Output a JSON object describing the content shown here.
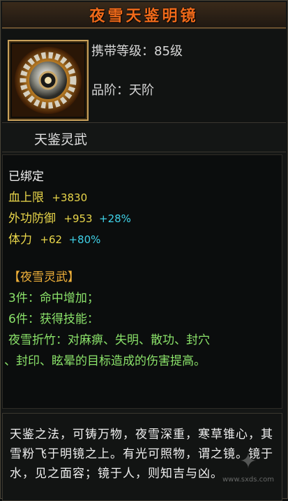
{
  "title": "夜雪天鉴明镜",
  "info": {
    "level_label": "携带等级：85级",
    "grade_label": "品阶：天阶"
  },
  "subtitle": "天鉴灵武",
  "stats": {
    "bound": "已绑定",
    "hp": {
      "label": "血上限",
      "value": "+3830"
    },
    "defense": {
      "label": "外功防御",
      "value": "+953",
      "bonus": "+28%"
    },
    "stamina": {
      "label": "体力",
      "value": "+62",
      "bonus": "+80%"
    },
    "set_title": "【夜雪灵武】",
    "set_3": "3件：命中增加；",
    "set_6": "6件：获得技能：",
    "skill_line1": "夜雪折竹：对麻痹、失明、散功、封穴",
    "skill_line2": "、封印、眩晕的目标造成的伤害提高。"
  },
  "description": "天鉴之法，可铸万物，夜雪深重，寒草锥心，其雪粉飞于明镜之上。有光可照物，谓之镜。镜于水，见之面容；镜于人，则知吉与凶。",
  "watermark": "www.sxds.com",
  "icon": "mirror-disc-icon"
}
